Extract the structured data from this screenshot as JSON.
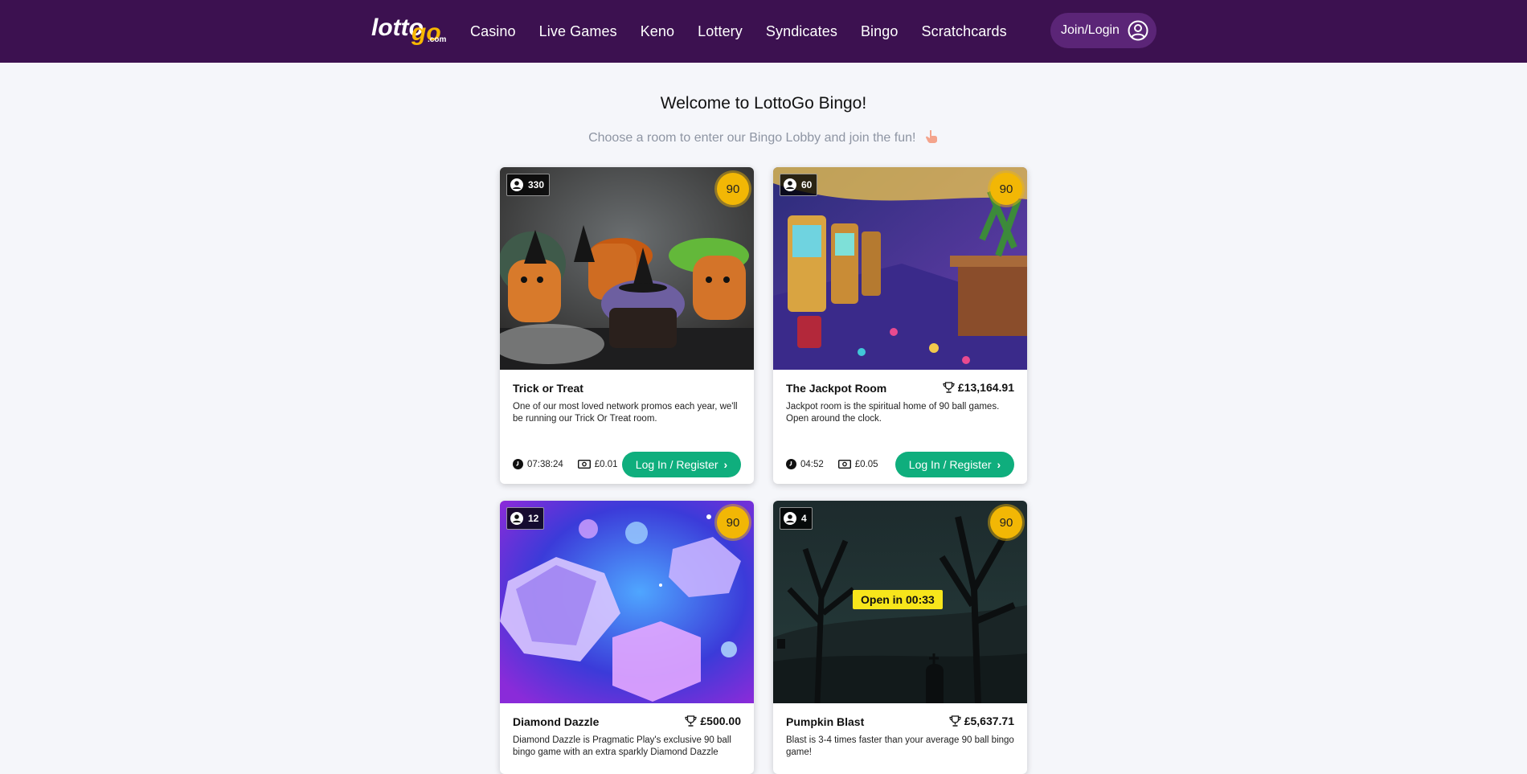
{
  "header": {
    "logo_text": "lottogo.com",
    "nav": [
      "Casino",
      "Live Games",
      "Keno",
      "Lottery",
      "Syndicates",
      "Bingo",
      "Scratchcards"
    ],
    "join_label": "Join/Login"
  },
  "hero": {
    "title": "Welcome to LottoGo Bingo!",
    "subtitle": "Choose a room to enter our Bingo Lobby and join the fun!"
  },
  "rooms": [
    {
      "name": "Trick or Treat",
      "players": "330",
      "ball": "90",
      "jackpot": "",
      "description": "One of our most loved network promos each year, we'll be running our Trick Or Treat room.",
      "time": "07:38:24",
      "price": "£0.01",
      "button": "Log In / Register"
    },
    {
      "name": "The Jackpot Room",
      "players": "60",
      "ball": "90",
      "jackpot": "£13,164.91",
      "description": "Jackpot room is the spiritual home of 90 ball games. Open around the clock.",
      "time": "04:52",
      "price": "£0.05",
      "button": "Log In / Register"
    },
    {
      "name": "Diamond Dazzle",
      "players": "12",
      "ball": "90",
      "jackpot": "£500.00",
      "description": "Diamond Dazzle is Pragmatic Play's exclusive 90 ball bingo game with an extra sparkly Diamond Dazzle"
    },
    {
      "name": "Pumpkin Blast",
      "players": "4",
      "ball": "90",
      "jackpot": "£5,637.71",
      "open_label": "Open in 00:33",
      "description": "Blast is 3-4 times faster than your average 90 ball bingo game!"
    }
  ],
  "colors": {
    "header_bg": "#3c1150",
    "button_green": "#0fae7d",
    "ball_yellow": "#f2b705",
    "open_badge": "#f7e51b"
  }
}
